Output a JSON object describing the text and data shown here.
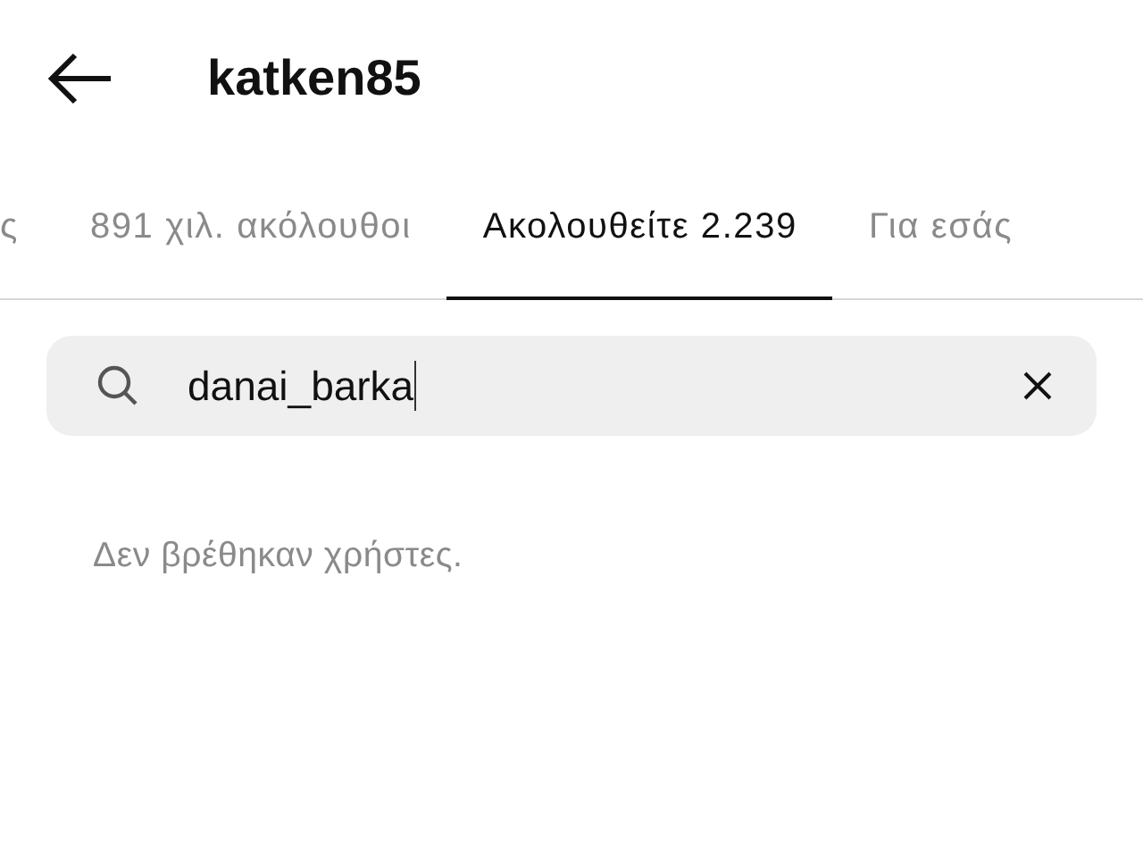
{
  "header": {
    "title": "katken85"
  },
  "tabs": [
    {
      "label": "ς",
      "selected": false
    },
    {
      "label": "891 χιλ. ακόλουθοι",
      "selected": false
    },
    {
      "label": "Ακολουθείτε 2.239",
      "selected": true
    },
    {
      "label": "Για εσάς",
      "selected": false
    }
  ],
  "search": {
    "value": "danai_barka"
  },
  "message": "Δεν βρέθηκαν χρήστες."
}
